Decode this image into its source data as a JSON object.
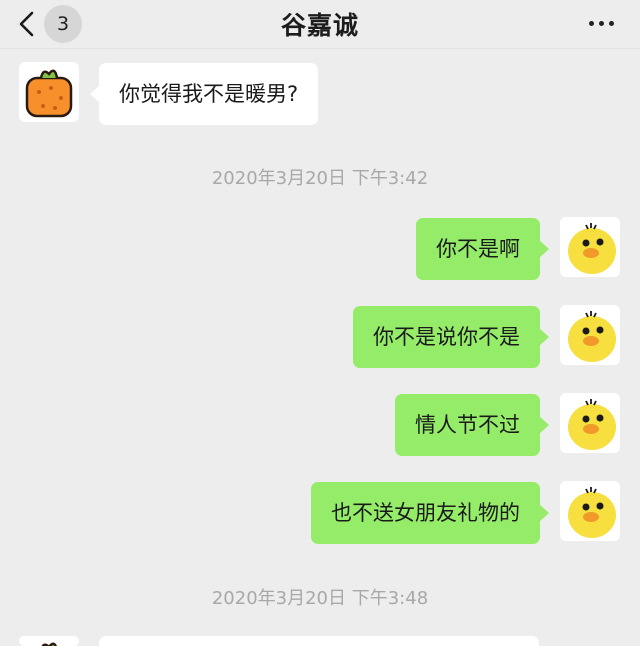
{
  "header": {
    "unread_count": "3",
    "contact_name": "谷嘉诚",
    "back_icon": "chevron-left-icon",
    "more_icon": "more-dots-icon"
  },
  "messages": [
    {
      "side": "left",
      "text": "你觉得我不是暖男?"
    },
    {
      "side": "right",
      "text": "你不是啊"
    },
    {
      "side": "right",
      "text": "你不是说你不是"
    },
    {
      "side": "right",
      "text": "情人节不过"
    },
    {
      "side": "right",
      "text": "也不送女朋友礼物的"
    }
  ],
  "timestamps": [
    "2020年3月20日 下午3:42",
    "2020年3月20日 下午3:48"
  ],
  "colors": {
    "background": "#ededed",
    "sent_bubble": "#95ec69",
    "received_bubble": "#ffffff",
    "timestamp_text": "#a8a8a8"
  },
  "avatars": {
    "contact": "orange-fruit-avatar",
    "self": "yellow-duck-avatar"
  }
}
